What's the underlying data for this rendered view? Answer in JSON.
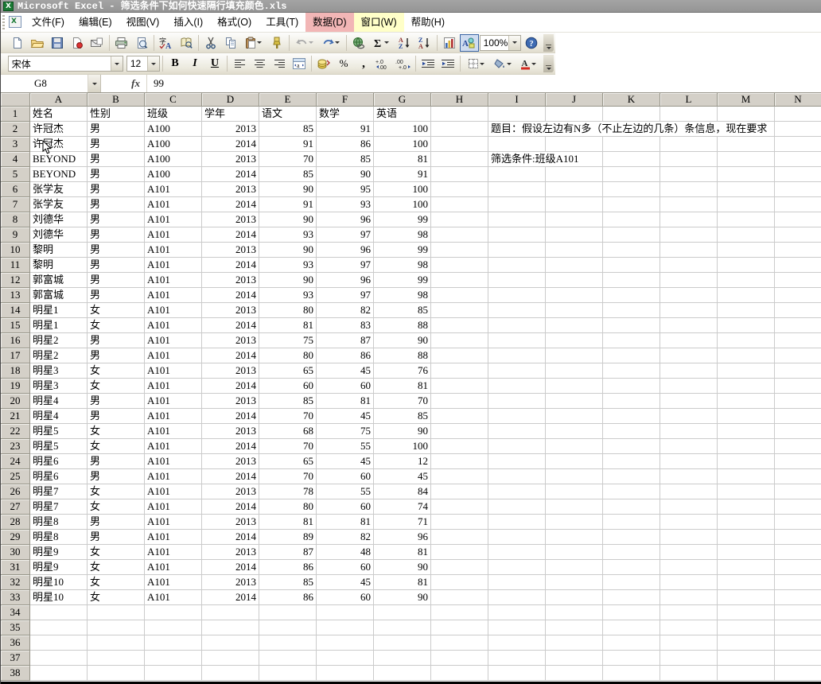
{
  "window": {
    "title": "Microsoft Excel - 筛选条件下如何快速隔行填充颜色.xls"
  },
  "menu": {
    "items": [
      {
        "name": "file",
        "label": "文件(F)"
      },
      {
        "name": "edit",
        "label": "编辑(E)"
      },
      {
        "name": "view",
        "label": "视图(V)"
      },
      {
        "name": "insert",
        "label": "插入(I)"
      },
      {
        "name": "format",
        "label": "格式(O)"
      },
      {
        "name": "tools",
        "label": "工具(T)"
      },
      {
        "name": "data",
        "label": "数据(D)",
        "highlight": "#f2b6b6"
      },
      {
        "name": "window",
        "label": "窗口(W)",
        "highlight": "#ffffc8"
      },
      {
        "name": "help",
        "label": "帮助(H)"
      }
    ]
  },
  "toolbar_standard": {
    "icons": [
      "new-document",
      "open-folder",
      "save",
      "permission",
      "mail",
      "print",
      "print-preview",
      "spell-check",
      "research",
      "cut",
      "copy",
      "paste",
      "format-painter",
      "undo",
      "redo",
      "insert-hyperlink",
      "autosum",
      "sort-ascending",
      "sort-descending",
      "chart-wizard",
      "drawing"
    ],
    "zoom_value": "100%",
    "help_icon": "help"
  },
  "toolbar_formatting": {
    "font_name": "宋体",
    "font_size": "12",
    "icons": [
      "bold",
      "italic",
      "underline",
      "align-left",
      "align-center",
      "align-right",
      "merge-center",
      "currency",
      "percent",
      "comma",
      "increase-decimal",
      "decrease-decimal",
      "decrease-indent",
      "increase-indent",
      "borders",
      "fill-color",
      "font-color"
    ]
  },
  "formula_bar": {
    "name_box": "G8",
    "formula": "99"
  },
  "sheet": {
    "column_letters": [
      "A",
      "B",
      "C",
      "D",
      "E",
      "F",
      "G",
      "H",
      "I",
      "J",
      "K",
      "L",
      "M",
      "N"
    ],
    "visible_rows": 38,
    "header_row": [
      "姓名",
      "性别",
      "班级",
      "学年",
      "语文",
      "数学",
      "英语"
    ],
    "rows": [
      [
        "许冠杰",
        "男",
        "A100",
        "2013",
        "85",
        "91",
        "100"
      ],
      [
        "许冠杰",
        "男",
        "A100",
        "2014",
        "91",
        "86",
        "100"
      ],
      [
        "BEYOND",
        "男",
        "A100",
        "2013",
        "70",
        "85",
        "81"
      ],
      [
        "BEYOND",
        "男",
        "A100",
        "2014",
        "85",
        "90",
        "91"
      ],
      [
        "张学友",
        "男",
        "A101",
        "2013",
        "90",
        "95",
        "100"
      ],
      [
        "张学友",
        "男",
        "A101",
        "2014",
        "91",
        "93",
        "100"
      ],
      [
        "刘德华",
        "男",
        "A101",
        "2013",
        "90",
        "96",
        "99"
      ],
      [
        "刘德华",
        "男",
        "A101",
        "2014",
        "93",
        "97",
        "98"
      ],
      [
        "黎明",
        "男",
        "A101",
        "2013",
        "90",
        "96",
        "99"
      ],
      [
        "黎明",
        "男",
        "A101",
        "2014",
        "93",
        "97",
        "98"
      ],
      [
        "郭富城",
        "男",
        "A101",
        "2013",
        "90",
        "96",
        "99"
      ],
      [
        "郭富城",
        "男",
        "A101",
        "2014",
        "93",
        "97",
        "98"
      ],
      [
        "明星1",
        "女",
        "A101",
        "2013",
        "80",
        "82",
        "85"
      ],
      [
        "明星1",
        "女",
        "A101",
        "2014",
        "81",
        "83",
        "88"
      ],
      [
        "明星2",
        "男",
        "A101",
        "2013",
        "75",
        "87",
        "90"
      ],
      [
        "明星2",
        "男",
        "A101",
        "2014",
        "80",
        "86",
        "88"
      ],
      [
        "明星3",
        "女",
        "A101",
        "2013",
        "65",
        "45",
        "76"
      ],
      [
        "明星3",
        "女",
        "A101",
        "2014",
        "60",
        "60",
        "81"
      ],
      [
        "明星4",
        "男",
        "A101",
        "2013",
        "85",
        "81",
        "70"
      ],
      [
        "明星4",
        "男",
        "A101",
        "2014",
        "70",
        "45",
        "85"
      ],
      [
        "明星5",
        "女",
        "A101",
        "2013",
        "68",
        "75",
        "90"
      ],
      [
        "明星5",
        "女",
        "A101",
        "2014",
        "70",
        "55",
        "100"
      ],
      [
        "明星6",
        "男",
        "A101",
        "2013",
        "65",
        "45",
        "12"
      ],
      [
        "明星6",
        "男",
        "A101",
        "2014",
        "70",
        "60",
        "45"
      ],
      [
        "明星7",
        "女",
        "A101",
        "2013",
        "78",
        "55",
        "84"
      ],
      [
        "明星7",
        "女",
        "A101",
        "2014",
        "80",
        "60",
        "74"
      ],
      [
        "明星8",
        "男",
        "A101",
        "2013",
        "81",
        "81",
        "71"
      ],
      [
        "明星8",
        "男",
        "A101",
        "2014",
        "89",
        "82",
        "96"
      ],
      [
        "明星9",
        "女",
        "A101",
        "2013",
        "87",
        "48",
        "81"
      ],
      [
        "明星9",
        "女",
        "A101",
        "2014",
        "86",
        "60",
        "90"
      ],
      [
        "明星10",
        "女",
        "A101",
        "2013",
        "85",
        "45",
        "81"
      ],
      [
        "明星10",
        "女",
        "A101",
        "2014",
        "86",
        "60",
        "90"
      ]
    ],
    "annotations": {
      "i2": "题目：假设左边有N多（不止左边的几条）条信息，现在要求",
      "i4": "筛选条件:班级A101"
    }
  },
  "colors": {
    "titlebar": "#9b9b9b",
    "menu_highlight_data": "#f2b6b6",
    "menu_highlight_window": "#ffffc8",
    "header_fill": "#d4d0c8",
    "gridline": "#cbcbcb"
  }
}
